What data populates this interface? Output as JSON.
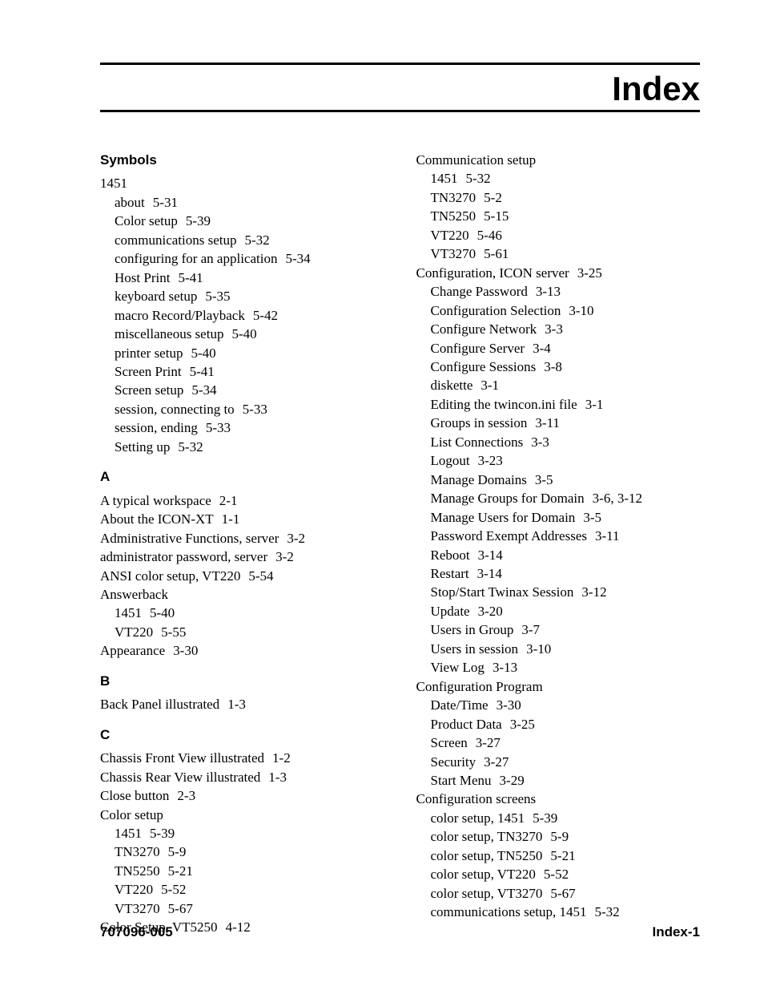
{
  "title": "Index",
  "footer": {
    "left": "707096-005",
    "right": "Index-1"
  },
  "sections": [
    {
      "heading": "Symbols",
      "entries": [
        {
          "level": 0,
          "term": "1451",
          "locator": ""
        },
        {
          "level": 1,
          "term": "about",
          "locator": "5-31"
        },
        {
          "level": 1,
          "term": "Color setup",
          "locator": "5-39"
        },
        {
          "level": 1,
          "term": "communications setup",
          "locator": "5-32"
        },
        {
          "level": 1,
          "term": "configuring for an application",
          "locator": "5-34"
        },
        {
          "level": 1,
          "term": "Host Print",
          "locator": "5-41"
        },
        {
          "level": 1,
          "term": "keyboard setup",
          "locator": "5-35"
        },
        {
          "level": 1,
          "term": "macro Record/Playback",
          "locator": "5-42"
        },
        {
          "level": 1,
          "term": "miscellaneous setup",
          "locator": "5-40"
        },
        {
          "level": 1,
          "term": "printer setup",
          "locator": "5-40"
        },
        {
          "level": 1,
          "term": "Screen Print",
          "locator": "5-41"
        },
        {
          "level": 1,
          "term": "Screen setup",
          "locator": "5-34"
        },
        {
          "level": 1,
          "term": "session, connecting to",
          "locator": "5-33"
        },
        {
          "level": 1,
          "term": "session, ending",
          "locator": "5-33"
        },
        {
          "level": 1,
          "term": "Setting up",
          "locator": "5-32"
        }
      ]
    },
    {
      "heading": "A",
      "entries": [
        {
          "level": 0,
          "term": "A typical workspace",
          "locator": "2-1"
        },
        {
          "level": 0,
          "term": "About the ICON-XT",
          "locator": "1-1"
        },
        {
          "level": 0,
          "term": "Administrative Functions, server",
          "locator": "3-2"
        },
        {
          "level": 0,
          "term": "administrator password, server",
          "locator": "3-2"
        },
        {
          "level": 0,
          "term": "ANSI color setup, VT220",
          "locator": "5-54"
        },
        {
          "level": 0,
          "term": "Answerback",
          "locator": ""
        },
        {
          "level": 1,
          "term": "1451",
          "locator": "5-40"
        },
        {
          "level": 1,
          "term": "VT220",
          "locator": "5-55"
        },
        {
          "level": 0,
          "term": "Appearance",
          "locator": "3-30"
        }
      ]
    },
    {
      "heading": "B",
      "entries": [
        {
          "level": 0,
          "term": "Back Panel illustrated",
          "locator": "1-3"
        }
      ]
    },
    {
      "heading": "C",
      "entries": [
        {
          "level": 0,
          "term": "Chassis Front View illustrated",
          "locator": "1-2"
        },
        {
          "level": 0,
          "term": "Chassis Rear View illustrated",
          "locator": "1-3"
        },
        {
          "level": 0,
          "term": "Close button",
          "locator": "2-3"
        },
        {
          "level": 0,
          "term": "Color setup",
          "locator": ""
        },
        {
          "level": 1,
          "term": "1451",
          "locator": "5-39"
        },
        {
          "level": 1,
          "term": "TN3270",
          "locator": "5-9"
        },
        {
          "level": 1,
          "term": "TN5250",
          "locator": "5-21"
        },
        {
          "level": 1,
          "term": "VT220",
          "locator": "5-52"
        },
        {
          "level": 1,
          "term": "VT3270",
          "locator": "5-67"
        },
        {
          "level": 0,
          "term": "Color Setup, VT5250",
          "locator": "4-12"
        },
        {
          "level": 0,
          "term": "Communication setup",
          "locator": ""
        },
        {
          "level": 1,
          "term": "1451",
          "locator": "5-32"
        },
        {
          "level": 1,
          "term": "TN3270",
          "locator": "5-2"
        },
        {
          "level": 1,
          "term": "TN5250",
          "locator": "5-15"
        },
        {
          "level": 1,
          "term": "VT220",
          "locator": "5-46"
        },
        {
          "level": 1,
          "term": "VT3270",
          "locator": "5-61"
        },
        {
          "level": 0,
          "term": "Configuration, ICON server",
          "locator": "3-25"
        },
        {
          "level": 1,
          "term": "Change Password",
          "locator": "3-13"
        },
        {
          "level": 1,
          "term": "Configuration Selection",
          "locator": "3-10"
        },
        {
          "level": 1,
          "term": "Configure Network",
          "locator": "3-3"
        },
        {
          "level": 1,
          "term": "Configure Server",
          "locator": "3-4"
        },
        {
          "level": 1,
          "term": "Configure Sessions",
          "locator": "3-8"
        },
        {
          "level": 1,
          "term": "diskette",
          "locator": "3-1"
        },
        {
          "level": 1,
          "term": "Editing the twincon.ini file",
          "locator": "3-1"
        },
        {
          "level": 1,
          "term": "Groups in session",
          "locator": "3-11"
        },
        {
          "level": 1,
          "term": "List Connections",
          "locator": "3-3"
        },
        {
          "level": 1,
          "term": "Logout",
          "locator": "3-23"
        },
        {
          "level": 1,
          "term": "Manage Domains",
          "locator": "3-5"
        },
        {
          "level": 1,
          "term": "Manage Groups for Domain",
          "locator": "3-6, 3-12"
        },
        {
          "level": 1,
          "term": "Manage Users for Domain",
          "locator": "3-5"
        },
        {
          "level": 1,
          "term": "Password Exempt Addresses",
          "locator": "3-11"
        },
        {
          "level": 1,
          "term": "Reboot",
          "locator": "3-14"
        },
        {
          "level": 1,
          "term": "Restart",
          "locator": "3-14"
        },
        {
          "level": 1,
          "term": "Stop/Start Twinax Session",
          "locator": "3-12"
        },
        {
          "level": 1,
          "term": "Update",
          "locator": "3-20"
        },
        {
          "level": 1,
          "term": "Users in Group",
          "locator": "3-7"
        },
        {
          "level": 1,
          "term": "Users in session",
          "locator": "3-10"
        },
        {
          "level": 1,
          "term": "View Log",
          "locator": "3-13"
        },
        {
          "level": 0,
          "term": "Configuration Program",
          "locator": ""
        },
        {
          "level": 1,
          "term": "Date/Time",
          "locator": "3-30"
        },
        {
          "level": 1,
          "term": "Product Data",
          "locator": "3-25"
        },
        {
          "level": 1,
          "term": "Screen",
          "locator": "3-27"
        },
        {
          "level": 1,
          "term": "Security",
          "locator": "3-27"
        },
        {
          "level": 1,
          "term": "Start Menu",
          "locator": "3-29"
        },
        {
          "level": 0,
          "term": "Configuration screens",
          "locator": ""
        },
        {
          "level": 1,
          "term": "color setup, 1451",
          "locator": "5-39"
        },
        {
          "level": 1,
          "term": "color setup, TN3270",
          "locator": "5-9"
        },
        {
          "level": 1,
          "term": "color setup, TN5250",
          "locator": "5-21"
        },
        {
          "level": 1,
          "term": "color setup, VT220",
          "locator": "5-52"
        },
        {
          "level": 1,
          "term": "color setup, VT3270",
          "locator": "5-67"
        },
        {
          "level": 1,
          "term": "communications setup, 1451",
          "locator": "5-32"
        }
      ]
    }
  ]
}
